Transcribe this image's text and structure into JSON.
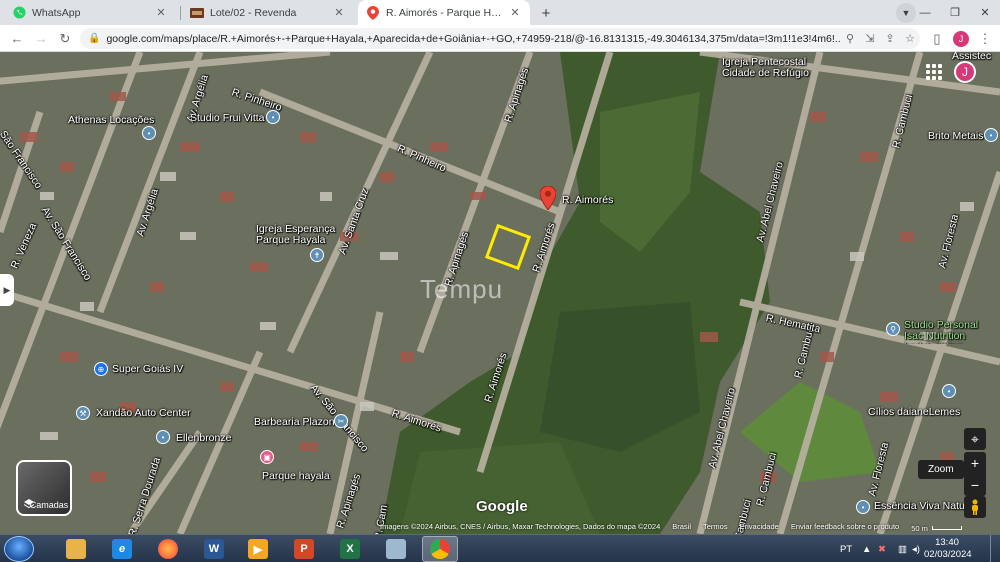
{
  "browser": {
    "tabs": [
      {
        "title": "WhatsApp",
        "active": false,
        "favicon": "whatsapp-icon",
        "color": "#25d366"
      },
      {
        "title": "Lote/02 - Revenda",
        "active": false,
        "favicon": "site-icon",
        "color": "#6b3a1e"
      },
      {
        "title": "R. Aimorés - Parque Hayala - Goi",
        "active": true,
        "favicon": "maps-icon",
        "color": "#ea4335"
      }
    ],
    "new_tab": "+",
    "url": "google.com/maps/place/R.+Aimorés+-+Parque+Hayala,+Aparecida+de+Goiânia+-+GO,+74959-218/@-16.8131315,-49.3046134,375m/data=!3m1!1e3!4m6!..."
  },
  "map": {
    "labels": [
      {
        "text": "R. Aimorés",
        "kind": "street"
      },
      {
        "text": "R. Pinheiro",
        "kind": "street"
      },
      {
        "text": "R. Pinheiro",
        "kind": "street"
      },
      {
        "text": "Av. Argélia",
        "kind": "street"
      },
      {
        "text": "Av. Argélia",
        "kind": "street"
      },
      {
        "text": "São Francisco",
        "kind": "street"
      },
      {
        "text": "Av. São Francisco",
        "kind": "street"
      },
      {
        "text": "R. Veneza",
        "kind": "street"
      },
      {
        "text": "Av. Santa Cruz",
        "kind": "street"
      },
      {
        "text": "R. Apinagés",
        "kind": "street"
      },
      {
        "text": "R. Apinagés",
        "kind": "street"
      },
      {
        "text": "R. Aimorés",
        "kind": "street"
      },
      {
        "text": "R. Aimorés",
        "kind": "street"
      },
      {
        "text": "R. Aimorés",
        "kind": "street"
      },
      {
        "text": "Av. São Francisco",
        "kind": "street"
      },
      {
        "text": "R. Apinagés",
        "kind": "street"
      },
      {
        "text": "R. Serra Dourada",
        "kind": "street"
      },
      {
        "text": "Av. Abel Chaveiro",
        "kind": "street"
      },
      {
        "text": "Av. Abel Chaveiro",
        "kind": "street"
      },
      {
        "text": "R. Cambuci",
        "kind": "street"
      },
      {
        "text": "R. Cambuci",
        "kind": "street"
      },
      {
        "text": "R. Cambuci",
        "kind": "street"
      },
      {
        "text": "R. Hematita",
        "kind": "street"
      },
      {
        "text": "Av. Floresta",
        "kind": "street"
      },
      {
        "text": "Av. Floresta",
        "kind": "street"
      },
      {
        "text": "R. Cam",
        "kind": "street"
      },
      {
        "text": "Cambuci",
        "kind": "street"
      },
      {
        "text": "Athenas Locações",
        "kind": "place"
      },
      {
        "text": "Studio Frui Vitta",
        "kind": "place"
      },
      {
        "text": "Igreja Esperança Parque Hayala",
        "kind": "place"
      },
      {
        "text": "Super Goiás IV",
        "kind": "place"
      },
      {
        "text": "Xandão Auto Center",
        "kind": "place"
      },
      {
        "text": "Barbearia Plazon",
        "kind": "place"
      },
      {
        "text": "Ellenbronze",
        "kind": "place"
      },
      {
        "text": "Parque hayala",
        "kind": "place"
      },
      {
        "text": "Igreja Pentecostal Cidade de Refúgio",
        "kind": "place"
      },
      {
        "text": "Assistec",
        "kind": "place"
      },
      {
        "text": "Brito Metais",
        "kind": "place"
      },
      {
        "text": "Studio Personal Isac Nutrition bodybuilding",
        "kind": "place"
      },
      {
        "text": "Cílios daianeLemes",
        "kind": "place"
      },
      {
        "text": "Essência Viva Natur",
        "kind": "place"
      }
    ],
    "watermark": "Tempu",
    "avatar_letter": "J",
    "layers_label": "Camadas",
    "zoom_tooltip": "Zoom",
    "google_logo": "Google",
    "attribution": {
      "imagery": "Imagens ©2024 Airbus, CNES / Airbus, Maxar Technologies, Dados do mapa ©2024",
      "country": "Brasil",
      "terms": "Termos",
      "privacy": "Privacidade",
      "feedback": "Enviar feedback sobre o produto",
      "scale": "50 m"
    }
  },
  "taskbar": {
    "apps": [
      {
        "name": "explorer",
        "label": "",
        "color": "#e8b44a"
      },
      {
        "name": "internet-explorer",
        "label": "e",
        "color": "#1e88e5"
      },
      {
        "name": "firefox",
        "label": "",
        "color": "#ff7139"
      },
      {
        "name": "word",
        "label": "W",
        "color": "#2b5797"
      },
      {
        "name": "media-player",
        "label": "▶",
        "color": "#f5a623"
      },
      {
        "name": "powerpoint",
        "label": "P",
        "color": "#d24726"
      },
      {
        "name": "excel",
        "label": "X",
        "color": "#217346"
      },
      {
        "name": "calculator",
        "label": "",
        "color": "#9eb8d0"
      },
      {
        "name": "chrome",
        "label": "",
        "color": "#4285f4"
      }
    ],
    "language": "PT",
    "time": "13:40",
    "date": "02/03/2024"
  }
}
